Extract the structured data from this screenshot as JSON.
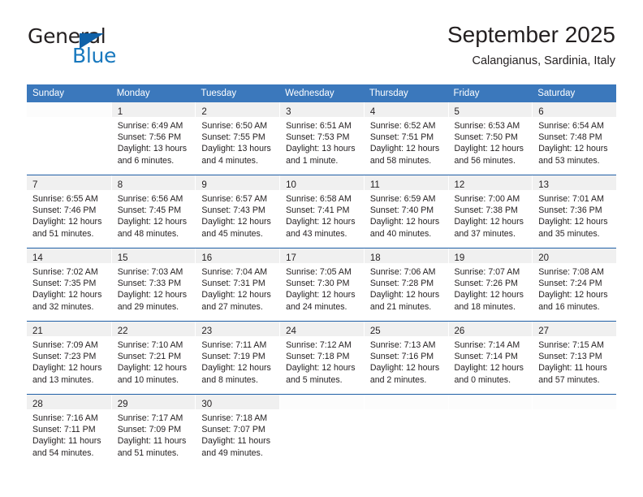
{
  "brand": {
    "name_top": "General",
    "name_bottom": "Blue",
    "accent_color": "#1878be",
    "triangle_color": "#1061a8"
  },
  "header": {
    "title": "September 2025",
    "subtitle": "Calangianus, Sardinia, Italy"
  },
  "theme": {
    "header_bar_color": "#3b78bc",
    "week_separator_color": "#1f5fa6",
    "daynum_band_color": "#f0f0f0",
    "text_color": "#231f20"
  },
  "calendar": {
    "weekday_headers": [
      "Sunday",
      "Monday",
      "Tuesday",
      "Wednesday",
      "Thursday",
      "Friday",
      "Saturday"
    ],
    "weeks": [
      [
        {
          "day": "",
          "lines": []
        },
        {
          "day": "1",
          "lines": [
            "Sunrise: 6:49 AM",
            "Sunset: 7:56 PM",
            "Daylight: 13 hours",
            "and 6 minutes."
          ]
        },
        {
          "day": "2",
          "lines": [
            "Sunrise: 6:50 AM",
            "Sunset: 7:55 PM",
            "Daylight: 13 hours",
            "and 4 minutes."
          ]
        },
        {
          "day": "3",
          "lines": [
            "Sunrise: 6:51 AM",
            "Sunset: 7:53 PM",
            "Daylight: 13 hours",
            "and 1 minute."
          ]
        },
        {
          "day": "4",
          "lines": [
            "Sunrise: 6:52 AM",
            "Sunset: 7:51 PM",
            "Daylight: 12 hours",
            "and 58 minutes."
          ]
        },
        {
          "day": "5",
          "lines": [
            "Sunrise: 6:53 AM",
            "Sunset: 7:50 PM",
            "Daylight: 12 hours",
            "and 56 minutes."
          ]
        },
        {
          "day": "6",
          "lines": [
            "Sunrise: 6:54 AM",
            "Sunset: 7:48 PM",
            "Daylight: 12 hours",
            "and 53 minutes."
          ]
        }
      ],
      [
        {
          "day": "7",
          "lines": [
            "Sunrise: 6:55 AM",
            "Sunset: 7:46 PM",
            "Daylight: 12 hours",
            "and 51 minutes."
          ]
        },
        {
          "day": "8",
          "lines": [
            "Sunrise: 6:56 AM",
            "Sunset: 7:45 PM",
            "Daylight: 12 hours",
            "and 48 minutes."
          ]
        },
        {
          "day": "9",
          "lines": [
            "Sunrise: 6:57 AM",
            "Sunset: 7:43 PM",
            "Daylight: 12 hours",
            "and 45 minutes."
          ]
        },
        {
          "day": "10",
          "lines": [
            "Sunrise: 6:58 AM",
            "Sunset: 7:41 PM",
            "Daylight: 12 hours",
            "and 43 minutes."
          ]
        },
        {
          "day": "11",
          "lines": [
            "Sunrise: 6:59 AM",
            "Sunset: 7:40 PM",
            "Daylight: 12 hours",
            "and 40 minutes."
          ]
        },
        {
          "day": "12",
          "lines": [
            "Sunrise: 7:00 AM",
            "Sunset: 7:38 PM",
            "Daylight: 12 hours",
            "and 37 minutes."
          ]
        },
        {
          "day": "13",
          "lines": [
            "Sunrise: 7:01 AM",
            "Sunset: 7:36 PM",
            "Daylight: 12 hours",
            "and 35 minutes."
          ]
        }
      ],
      [
        {
          "day": "14",
          "lines": [
            "Sunrise: 7:02 AM",
            "Sunset: 7:35 PM",
            "Daylight: 12 hours",
            "and 32 minutes."
          ]
        },
        {
          "day": "15",
          "lines": [
            "Sunrise: 7:03 AM",
            "Sunset: 7:33 PM",
            "Daylight: 12 hours",
            "and 29 minutes."
          ]
        },
        {
          "day": "16",
          "lines": [
            "Sunrise: 7:04 AM",
            "Sunset: 7:31 PM",
            "Daylight: 12 hours",
            "and 27 minutes."
          ]
        },
        {
          "day": "17",
          "lines": [
            "Sunrise: 7:05 AM",
            "Sunset: 7:30 PM",
            "Daylight: 12 hours",
            "and 24 minutes."
          ]
        },
        {
          "day": "18",
          "lines": [
            "Sunrise: 7:06 AM",
            "Sunset: 7:28 PM",
            "Daylight: 12 hours",
            "and 21 minutes."
          ]
        },
        {
          "day": "19",
          "lines": [
            "Sunrise: 7:07 AM",
            "Sunset: 7:26 PM",
            "Daylight: 12 hours",
            "and 18 minutes."
          ]
        },
        {
          "day": "20",
          "lines": [
            "Sunrise: 7:08 AM",
            "Sunset: 7:24 PM",
            "Daylight: 12 hours",
            "and 16 minutes."
          ]
        }
      ],
      [
        {
          "day": "21",
          "lines": [
            "Sunrise: 7:09 AM",
            "Sunset: 7:23 PM",
            "Daylight: 12 hours",
            "and 13 minutes."
          ]
        },
        {
          "day": "22",
          "lines": [
            "Sunrise: 7:10 AM",
            "Sunset: 7:21 PM",
            "Daylight: 12 hours",
            "and 10 minutes."
          ]
        },
        {
          "day": "23",
          "lines": [
            "Sunrise: 7:11 AM",
            "Sunset: 7:19 PM",
            "Daylight: 12 hours",
            "and 8 minutes."
          ]
        },
        {
          "day": "24",
          "lines": [
            "Sunrise: 7:12 AM",
            "Sunset: 7:18 PM",
            "Daylight: 12 hours",
            "and 5 minutes."
          ]
        },
        {
          "day": "25",
          "lines": [
            "Sunrise: 7:13 AM",
            "Sunset: 7:16 PM",
            "Daylight: 12 hours",
            "and 2 minutes."
          ]
        },
        {
          "day": "26",
          "lines": [
            "Sunrise: 7:14 AM",
            "Sunset: 7:14 PM",
            "Daylight: 12 hours",
            "and 0 minutes."
          ]
        },
        {
          "day": "27",
          "lines": [
            "Sunrise: 7:15 AM",
            "Sunset: 7:13 PM",
            "Daylight: 11 hours",
            "and 57 minutes."
          ]
        }
      ],
      [
        {
          "day": "28",
          "lines": [
            "Sunrise: 7:16 AM",
            "Sunset: 7:11 PM",
            "Daylight: 11 hours",
            "and 54 minutes."
          ]
        },
        {
          "day": "29",
          "lines": [
            "Sunrise: 7:17 AM",
            "Sunset: 7:09 PM",
            "Daylight: 11 hours",
            "and 51 minutes."
          ]
        },
        {
          "day": "30",
          "lines": [
            "Sunrise: 7:18 AM",
            "Sunset: 7:07 PM",
            "Daylight: 11 hours",
            "and 49 minutes."
          ]
        },
        {
          "day": "",
          "lines": []
        },
        {
          "day": "",
          "lines": []
        },
        {
          "day": "",
          "lines": []
        },
        {
          "day": "",
          "lines": []
        }
      ]
    ]
  }
}
